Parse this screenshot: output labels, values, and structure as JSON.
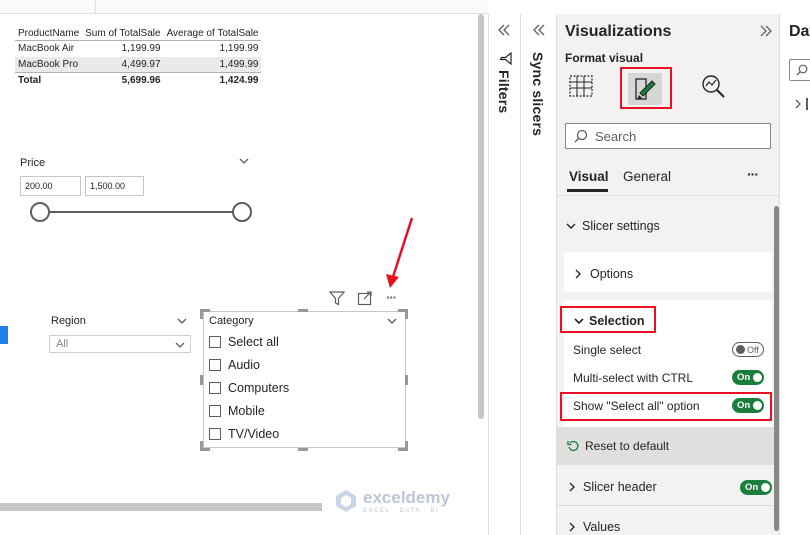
{
  "table": {
    "headers": [
      "ProductName",
      "Sum of TotalSale",
      "Average of TotalSale"
    ],
    "rows": [
      [
        "MacBook Air",
        "1,199.99",
        "1,199.99"
      ],
      [
        "MacBook Pro",
        "4,499.97",
        "1,499.99"
      ]
    ],
    "total": [
      "Total",
      "5,699.96",
      "1,424.99"
    ]
  },
  "price_slicer": {
    "title": "Price",
    "min_value": "200.00",
    "max_value": "1,500.00"
  },
  "region_slicer": {
    "title": "Region",
    "selected": "All"
  },
  "category_slicer": {
    "title": "Category",
    "items": [
      "Select all",
      "Audio",
      "Computers",
      "Mobile",
      "TV/Video"
    ]
  },
  "watermark": {
    "name": "exceldemy",
    "tagline": "EXCEL · DATA · BI"
  },
  "side_tabs": {
    "filters": "Filters",
    "sync_slicers": "Sync slicers"
  },
  "viz": {
    "title": "Visualizations",
    "format_visual": "Format visual",
    "search_placeholder": "Search",
    "tabs": {
      "visual": "Visual",
      "general": "General"
    },
    "more": "···",
    "slicer_settings": "Slicer settings",
    "options": "Options",
    "selection": "Selection",
    "single_select": {
      "label": "Single select",
      "state": "Off"
    },
    "multi_select": {
      "label": "Multi-select with CTRL",
      "state": "On"
    },
    "show_select_all": {
      "label": "Show \"Select all\" option",
      "state": "On"
    },
    "reset": "Reset to default",
    "slicer_header": {
      "label": "Slicer header",
      "state": "On"
    },
    "values": "Values"
  },
  "data_panel": {
    "title": "Dat"
  },
  "colors": {
    "accent_red": "#e81123",
    "toggle_green": "#1a7f3c",
    "panel_bg": "#f3f2f1"
  }
}
